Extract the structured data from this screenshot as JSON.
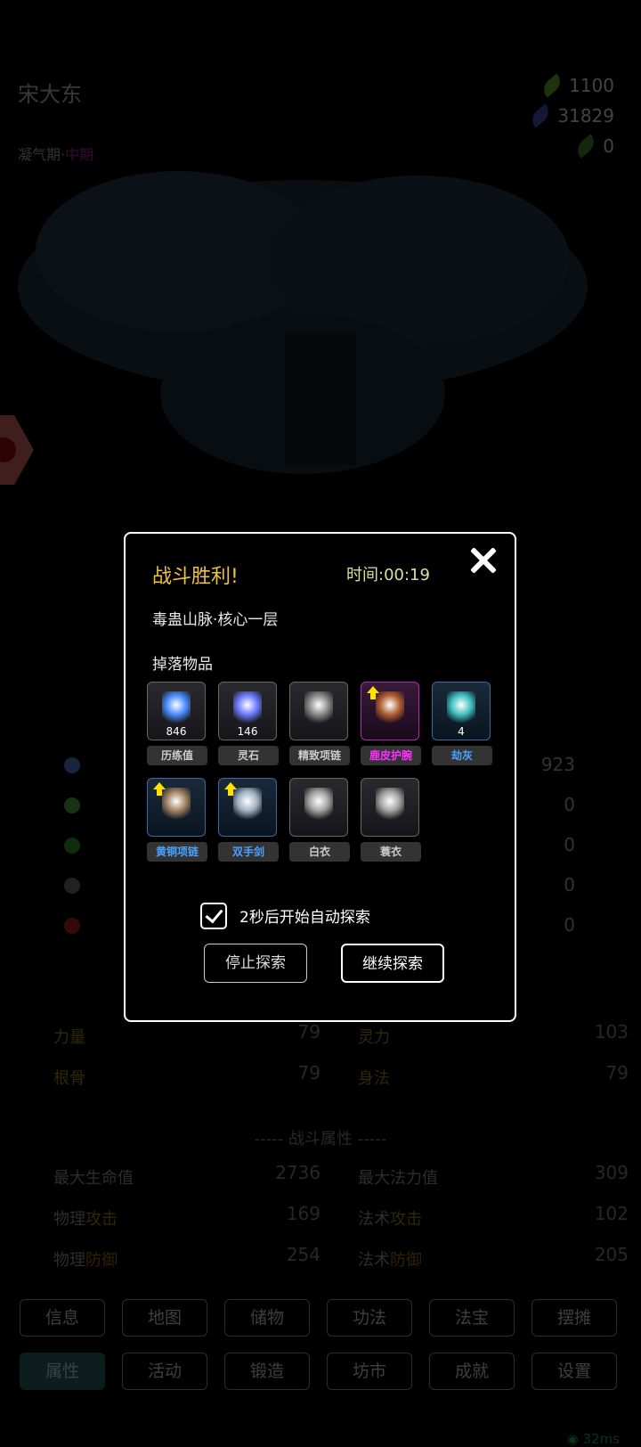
{
  "header": {
    "player_name": "宋大东",
    "realm": "凝气期",
    "realm_sep": "·",
    "stage": "中期",
    "currencies": [
      {
        "icon": "green-leaf-icon",
        "color": "#5a9a2a",
        "value": "1100"
      },
      {
        "icon": "blue-leaf-icon",
        "color": "#3a4aa0",
        "value": "31829"
      },
      {
        "icon": "dark-green-leaf-icon",
        "color": "#3a7a2a",
        "value": "0"
      }
    ]
  },
  "resources": [
    {
      "icon": "spirit-stone-icon",
      "color": "#4a70c0",
      "value": "923"
    },
    {
      "icon": "leaf-icon",
      "color": "#4a9a3a",
      "value": "0"
    },
    {
      "icon": "herb-icon",
      "color": "#2a8a2a",
      "value": "0"
    },
    {
      "icon": "feather-icon",
      "color": "#666666",
      "value": "0"
    },
    {
      "icon": "flame-icon",
      "color": "#a02020",
      "value": "0"
    }
  ],
  "base_stats": [
    {
      "label1": "力量",
      "value1": "79",
      "label2": "灵力",
      "value2": "103"
    },
    {
      "label1": "根骨",
      "value1": "79",
      "label2": "身法",
      "value2": "79"
    }
  ],
  "combat_section_title": "----- 战斗属性 -----",
  "combat_stats": {
    "max_hp_label": "最大生命值",
    "max_hp": "2736",
    "max_mp_label": "最大法力值",
    "max_mp": "309",
    "phys_atk_a": "物理",
    "phys_atk_b": "攻击",
    "phys_atk": "169",
    "mag_atk_a": "法术",
    "mag_atk_b": "攻击",
    "mag_atk": "102",
    "phys_def_a": "物理",
    "phys_def_b": "防御",
    "phys_def": "254",
    "mag_def_a": "法术",
    "mag_def_b": "防御",
    "mag_def": "205"
  },
  "nav": {
    "row1": [
      "信息",
      "地图",
      "储物",
      "功法",
      "法宝",
      "摆摊"
    ],
    "row2": [
      "属性",
      "活动",
      "锻造",
      "坊市",
      "成就",
      "设置"
    ],
    "active": "属性"
  },
  "ping": "32ms",
  "modal": {
    "title": "战斗胜利!",
    "time_label": "时间:",
    "time_value": "00:19",
    "location": "毒蛊山脉·核心一层",
    "drops_label": "掉落物品",
    "items": [
      {
        "name": "历练值",
        "qty": "846",
        "rarity": "normal",
        "name_color": "#cccccc",
        "icon_color": "#4a8aff",
        "upgrade": false
      },
      {
        "name": "灵石",
        "qty": "146",
        "rarity": "normal",
        "name_color": "#cccccc",
        "icon_color": "#6a7aff",
        "upgrade": false
      },
      {
        "name": "精致项链",
        "qty": "",
        "rarity": "normal",
        "name_color": "#cccccc",
        "icon_color": "#888888",
        "upgrade": false
      },
      {
        "name": "鹿皮护腕",
        "qty": "",
        "rarity": "purple",
        "name_color": "#ff30ff",
        "icon_color": "#b06030",
        "upgrade": true
      },
      {
        "name": "劫灰",
        "qty": "4",
        "rarity": "blue",
        "name_color": "#4aa0ff",
        "icon_color": "#40c0c0",
        "upgrade": false
      },
      {
        "name": "黄铜项链",
        "qty": "",
        "rarity": "blue",
        "name_color": "#4aa0ff",
        "icon_color": "#a08060",
        "upgrade": true
      },
      {
        "name": "双手剑",
        "qty": "",
        "rarity": "blue",
        "name_color": "#4aa0ff",
        "icon_color": "#a0b0c0",
        "upgrade": true
      },
      {
        "name": "白衣",
        "qty": "",
        "rarity": "normal",
        "name_color": "#cccccc",
        "icon_color": "#a0a0a0",
        "upgrade": false
      },
      {
        "name": "蓑衣",
        "qty": "",
        "rarity": "normal",
        "name_color": "#cccccc",
        "icon_color": "#a0a0a0",
        "upgrade": false
      }
    ],
    "auto_explore_label": "2秒后开始自动探索",
    "auto_explore_checked": true,
    "stop_button": "停止探索",
    "continue_button": "继续探索"
  }
}
